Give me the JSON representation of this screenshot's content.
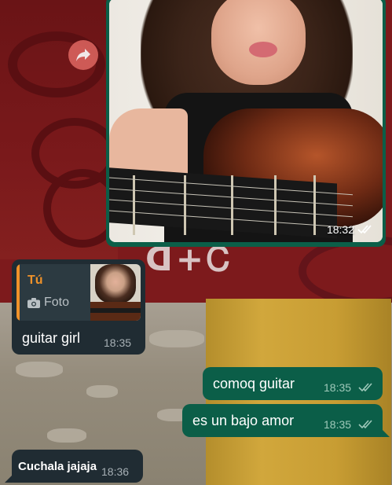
{
  "photo_message": {
    "time": "18:32",
    "status_icon": "double-check-read-icon"
  },
  "forward_button": {
    "icon": "forward-arrow-icon"
  },
  "reply_message": {
    "quote": {
      "author": "Tú",
      "type_label": "Foto",
      "type_icon": "camera-icon"
    },
    "text": "guitar girl",
    "time": "18:35"
  },
  "messages": [
    {
      "direction": "outgoing",
      "text": "comoq guitar",
      "time": "18:35",
      "status_icon": "double-check-icon"
    },
    {
      "direction": "outgoing",
      "text": "es un bajo amor",
      "time": "18:35",
      "status_icon": "double-check-icon"
    },
    {
      "direction": "incoming",
      "text": "Cuchala jajaja",
      "time": "18:36"
    }
  ],
  "colors": {
    "incoming_bubble": "#202c33",
    "outgoing_bubble": "#0b5e48",
    "quote_accent": "#f0922a"
  }
}
